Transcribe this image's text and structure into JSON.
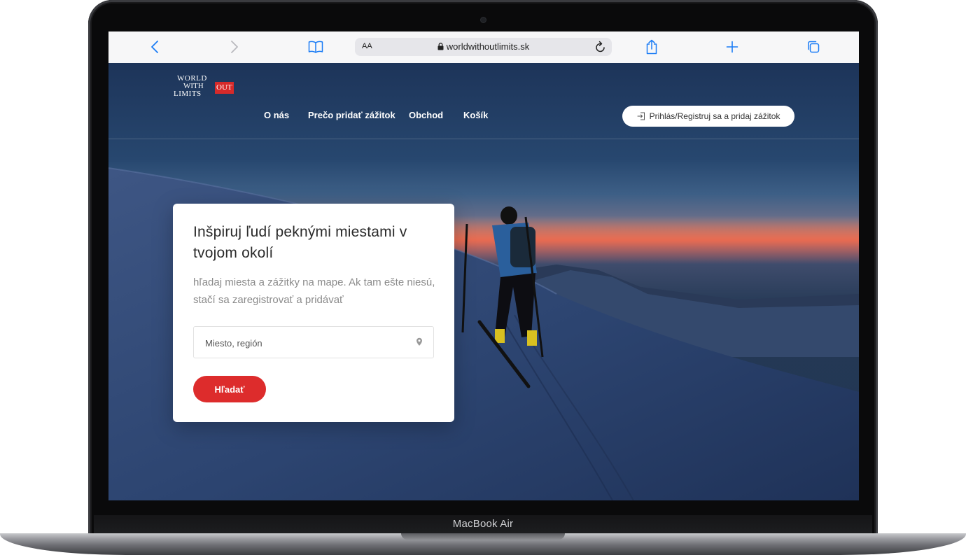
{
  "device": {
    "label": "MacBook Air"
  },
  "browser": {
    "text_size_label": "AA",
    "url": "worldwithoutlimits.sk"
  },
  "logo": {
    "line1": "WORLD",
    "line2": "WITH",
    "line3": "LIMITS",
    "badge": "OUT"
  },
  "nav": {
    "items": [
      {
        "label": "O nás"
      },
      {
        "label": "Prečo pridať zážitok"
      },
      {
        "label": "Obchod"
      },
      {
        "label": "Košík"
      }
    ],
    "login_label": "Prihlás/Registruj sa a pridaj zážitok"
  },
  "hero": {
    "title": "Inšpiruj ľudí peknými miestami v tvojom okolí",
    "subtitle": "hľadaj miesta a zážitky na mape. Ak tam ešte niesú, stačí sa zaregistrovať a pridávať",
    "search_placeholder": "Miesto, región",
    "search_button": "Hľadať"
  },
  "colors": {
    "accent": "#dd2c2c",
    "safari_blue": "#1a7cf5"
  }
}
